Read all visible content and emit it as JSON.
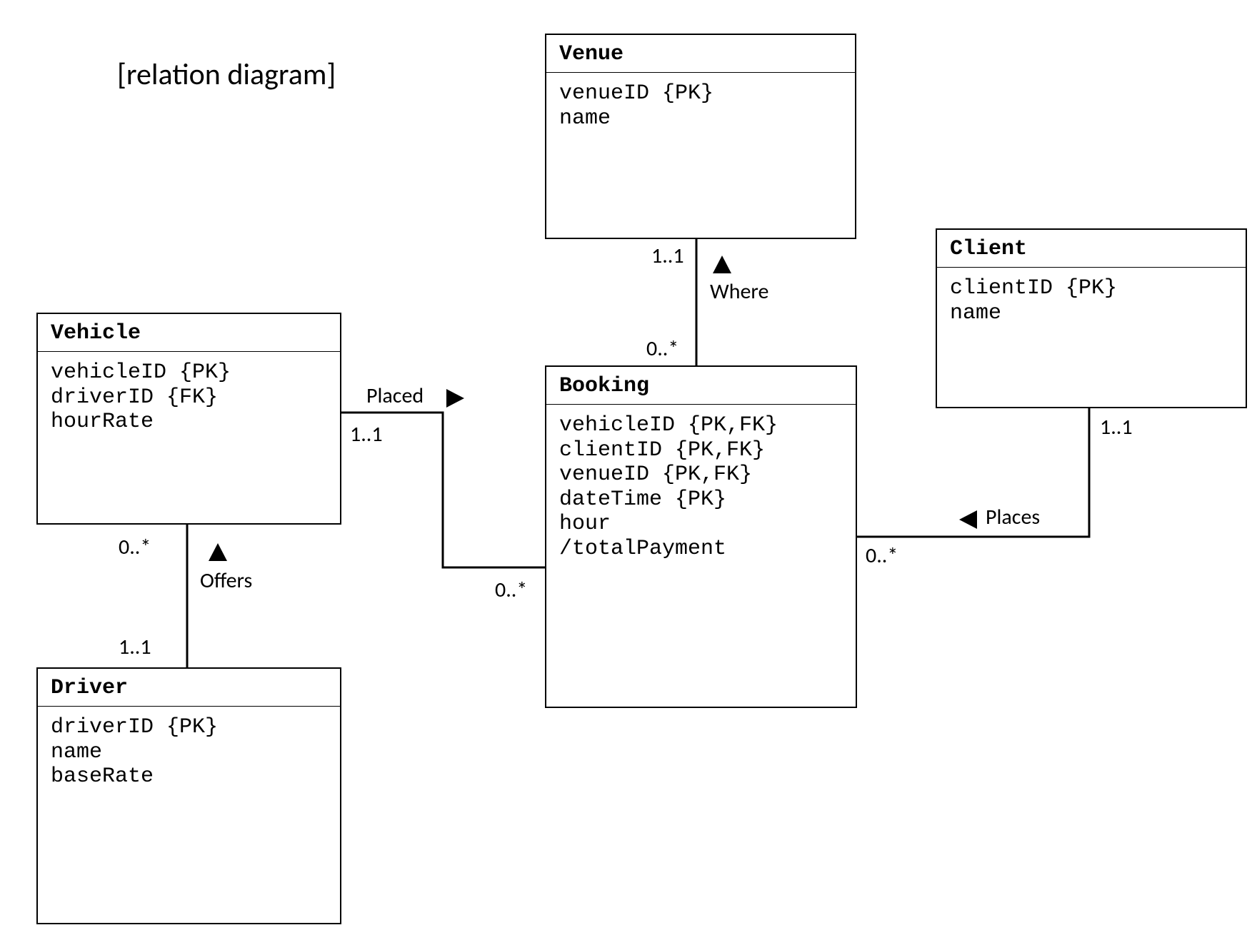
{
  "title": "[relation diagram]",
  "entities": {
    "vehicle": {
      "name": "Vehicle",
      "attrs": [
        "vehicleID {PK}",
        "driverID {FK}",
        "hourRate"
      ]
    },
    "venue": {
      "name": "Venue",
      "attrs": [
        "venueID {PK}",
        "name"
      ]
    },
    "client": {
      "name": "Client",
      "attrs": [
        "clientID {PK}",
        "name"
      ]
    },
    "booking": {
      "name": "Booking",
      "attrs": [
        "vehicleID {PK,FK}",
        "clientID {PK,FK}",
        "venueID {PK,FK}",
        "dateTime {PK}",
        "hour",
        "/totalPayment"
      ]
    },
    "driver": {
      "name": "Driver",
      "attrs": [
        "driverID {PK}",
        "name",
        "baseRate"
      ]
    }
  },
  "relations": {
    "placed": {
      "label": "Placed",
      "near": "Vehicle→Booking",
      "mult_from": "1..1",
      "mult_to": "0..*"
    },
    "where": {
      "label": "Where",
      "near": "Booking→Venue",
      "mult_from": "0..*",
      "mult_to": "1..1"
    },
    "places": {
      "label": "Places",
      "near": "Client→Booking",
      "mult_from": "1..1",
      "mult_to": "0..*"
    },
    "offers": {
      "label": "Offers",
      "near": "Driver→Vehicle",
      "mult_from": "1..1",
      "mult_to": "0..*"
    }
  }
}
